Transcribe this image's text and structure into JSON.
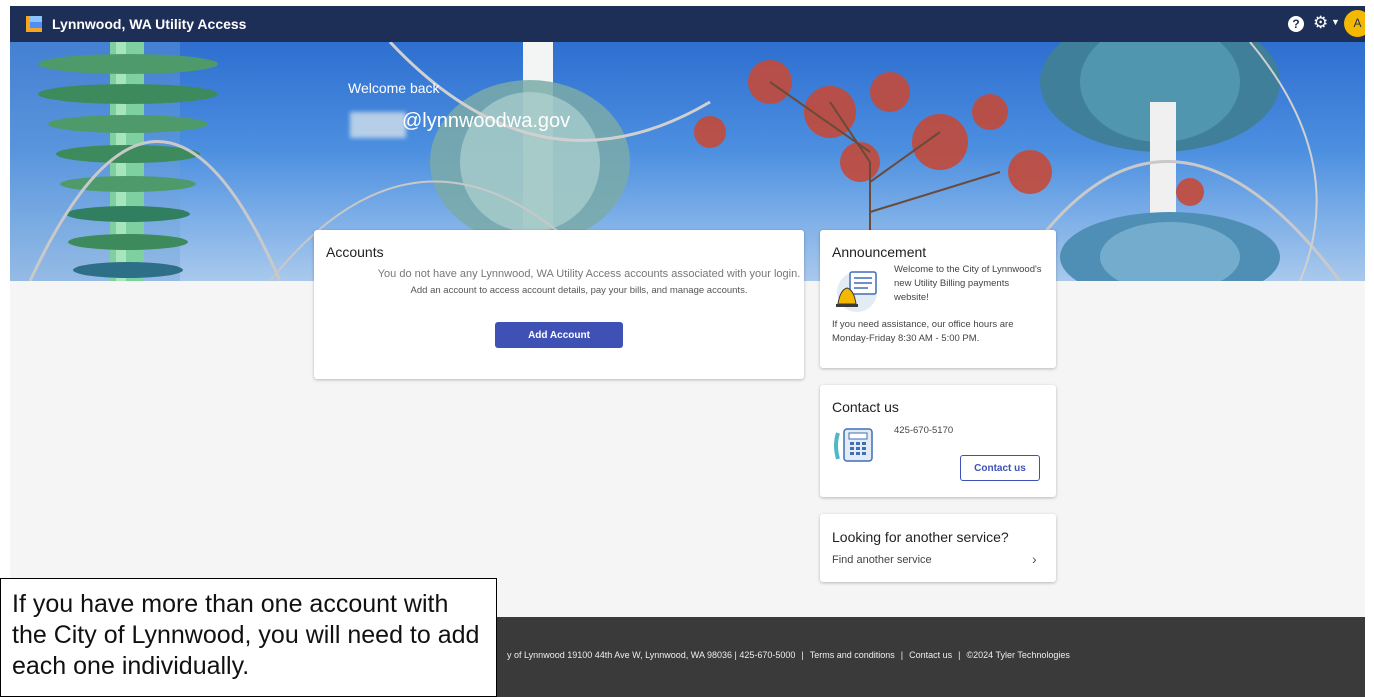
{
  "header": {
    "app_title": "Lynnwood, WA Utility Access",
    "help_icon": "question-circle-icon",
    "settings_icon": "gear-icon",
    "avatar_initial": "A"
  },
  "hero": {
    "welcome": "Welcome back",
    "email_domain": "@lynnwoodwa.gov"
  },
  "accounts": {
    "title": "Accounts",
    "message1": "You do not have any Lynnwood, WA Utility Access accounts associated with your login.",
    "message2": "Add an account to access account details, pay your bills, and manage accounts.",
    "add_button": "Add Account"
  },
  "announcement": {
    "title": "Announcement",
    "text": "Welcome to the City of Lynnwood's new Utility Billing payments website!",
    "hours": "If you need assistance, our office hours are Monday-Friday 8:30 AM - 5:00 PM."
  },
  "contact": {
    "title": "Contact us",
    "phone": "425-670-5170",
    "button": "Contact us"
  },
  "service": {
    "title": "Looking for another service?",
    "link": "Find another service"
  },
  "footer": {
    "address": "y of Lynnwood 19100 44th Ave W, Lynnwood, WA 98036 | 425-670-5000",
    "terms": "Terms and conditions",
    "contact": "Contact us",
    "copyright": "©2024 Tyler Technologies"
  },
  "callout": {
    "text": "If you have more than one account with the City of Lynnwood, you will need to add each one individually."
  },
  "colors": {
    "topbar": "#1e2f57",
    "primary_button": "#3f51b5",
    "avatar": "#f5b800",
    "footer": "#3a3a3a"
  }
}
